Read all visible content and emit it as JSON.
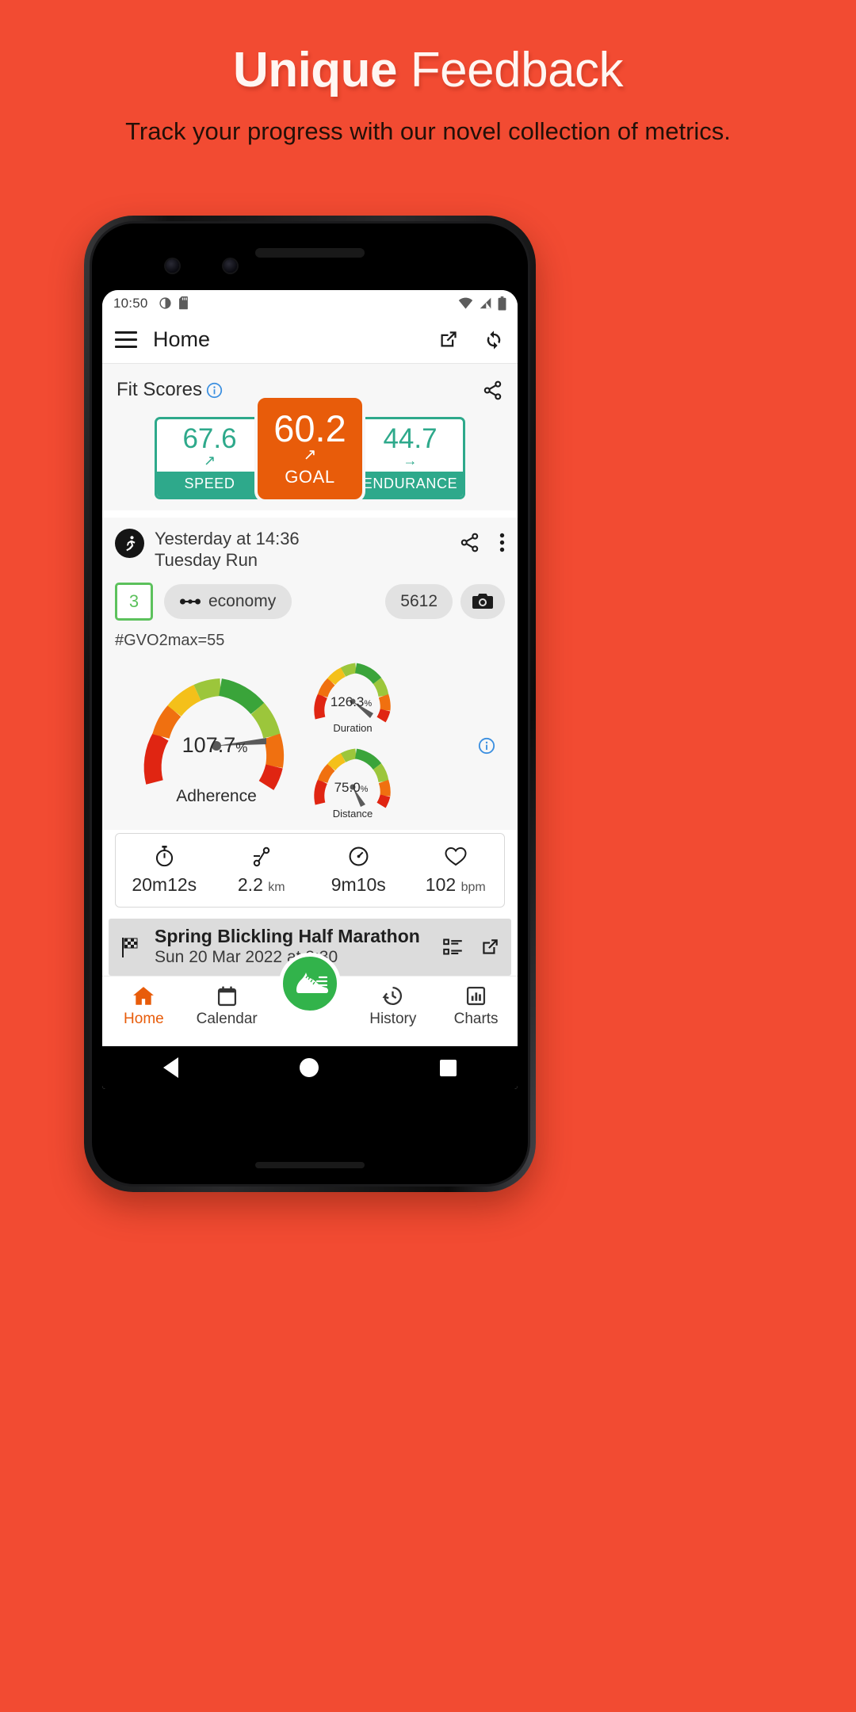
{
  "promo": {
    "title_bold": "Unique",
    "title_light": " Feedback",
    "subtitle": "Track your progress with our novel collection of metrics."
  },
  "colors": {
    "background": "#F24B32",
    "accent_orange": "#E85C0A",
    "teal": "#2EA98B",
    "green": "#32B34B",
    "info_blue": "#3b8fe0"
  },
  "statusbar": {
    "time": "10:50",
    "icons": [
      "brightness-icon",
      "sd-card-icon",
      "wifi-icon",
      "cellular-signal-icon",
      "battery-icon"
    ]
  },
  "appbar": {
    "title": "Home",
    "menu_icon": "hamburger-menu-icon",
    "actions": [
      "external-link-icon",
      "sync-refresh-icon"
    ]
  },
  "fit_scores": {
    "title": "Fit Scores",
    "info_icon": "info-icon",
    "share_icon": "share-icon",
    "tiles": [
      {
        "value": "67.6",
        "label": "SPEED",
        "trend": "trending-up-icon",
        "trend_glyph": "↗"
      },
      {
        "value": "60.2",
        "label": "GOAL",
        "trend": "trending-up-icon",
        "trend_glyph": "↗"
      },
      {
        "value": "44.7",
        "label": "ENDURANCE",
        "trend": "trending-flat-icon",
        "trend_glyph": "→"
      }
    ]
  },
  "activity": {
    "avatar_icon": "running-person-icon",
    "when": "Yesterday at 14:36",
    "name": "Tuesday Run",
    "share_icon": "share-icon",
    "more_icon": "more-vertical-icon",
    "rating": "3",
    "tag_label": "economy",
    "tag_icon": "dumbbell-icon",
    "steps": "5612",
    "photo_icon": "camera-icon",
    "hashtag": "#GVO2max=55",
    "info_icon": "info-icon",
    "gauges": [
      {
        "name": "adherence-gauge",
        "value": "107.7",
        "unit": "%",
        "label": "Adherence",
        "percent": 107.7
      },
      {
        "name": "duration-gauge",
        "value": "126.3",
        "unit": "%",
        "label": "Duration",
        "percent": 126.3
      },
      {
        "name": "distance-gauge",
        "value": "75.0",
        "unit": "%",
        "label": "Distance",
        "percent": 75.0
      }
    ],
    "metrics": [
      {
        "icon": "stopwatch-icon",
        "value": "20m12s",
        "unit": ""
      },
      {
        "icon": "route-distance-icon",
        "value": "2.2",
        "unit": "km"
      },
      {
        "icon": "speedometer-icon",
        "value": "9m10s",
        "unit": ""
      },
      {
        "icon": "heart-icon",
        "value": "102",
        "unit": "bpm"
      }
    ]
  },
  "event": {
    "icon": "checkered-flag-icon",
    "title": "Spring Blickling Half Marathon",
    "date": "Sun 20 Mar 2022 at 8:30",
    "list_icon": "list-details-icon",
    "open_icon": "external-link-icon"
  },
  "bottom_nav": {
    "items": [
      {
        "label": "Home",
        "icon": "home-icon",
        "active": true
      },
      {
        "label": "Calendar",
        "icon": "calendar-icon",
        "active": false
      },
      {
        "label": "History",
        "icon": "history-clock-icon",
        "active": false
      },
      {
        "label": "Charts",
        "icon": "bar-chart-icon",
        "active": false
      }
    ],
    "fab_icon": "running-shoe-icon"
  },
  "android_nav": {
    "back": "back-triangle-icon",
    "home": "home-circle-icon",
    "recents": "recents-square-icon"
  }
}
